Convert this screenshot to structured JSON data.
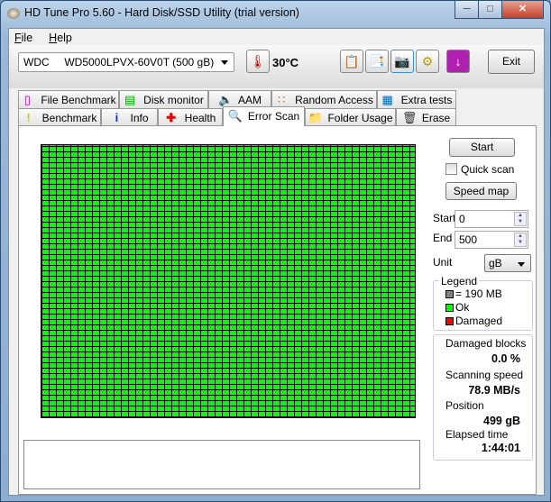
{
  "window": {
    "title": "HD Tune Pro 5.60 - Hard Disk/SSD Utility (trial version)"
  },
  "menu": [
    {
      "label": "File",
      "u": "F",
      "rest": "ile"
    },
    {
      "label": "Help",
      "u": "H",
      "rest": "elp"
    }
  ],
  "toolbar": {
    "drive": "WDC     WD5000LPVX-60V0T (500 gB)",
    "temperature": "30°C",
    "exit_label": "Exit"
  },
  "tabs_row1": [
    {
      "label": "File Benchmark",
      "icon": "file-benchmark-icon"
    },
    {
      "label": "Disk monitor",
      "icon": "disk-monitor-icon"
    },
    {
      "label": "AAM",
      "icon": "speaker-icon"
    },
    {
      "label": "Random Access",
      "icon": "random-access-icon"
    },
    {
      "label": "Extra tests",
      "icon": "extra-tests-icon"
    }
  ],
  "tabs_row2": [
    {
      "label": "Benchmark",
      "icon": "exclamation-icon"
    },
    {
      "label": "Info",
      "icon": "info-icon"
    },
    {
      "label": "Health",
      "icon": "health-cross-icon"
    },
    {
      "label": "Error Scan",
      "icon": "magnifier-icon",
      "active": true
    },
    {
      "label": "Folder Usage",
      "icon": "folder-icon"
    },
    {
      "label": "Erase",
      "icon": "trash-icon"
    }
  ],
  "controls": {
    "start_label": "Start",
    "quick_scan_label": "Quick scan",
    "quick_scan_checked": false,
    "speed_map_label": "Speed map",
    "start_field_label": "Start",
    "start_value": "0",
    "end_field_label": "End",
    "end_value": "500",
    "unit_label": "Unit",
    "unit_value": "gB"
  },
  "legend": {
    "title": "Legend",
    "items": [
      {
        "label": "= 190 MB",
        "color": "#808080"
      },
      {
        "label": "Ok",
        "color": "#00ff00"
      },
      {
        "label": "Damaged",
        "color": "#ff0000"
      }
    ]
  },
  "stats": {
    "damaged_blocks_label": "Damaged blocks",
    "damaged_blocks": "0.0 %",
    "speed_label": "Scanning speed",
    "speed": "78.9 MB/s",
    "position_label": "Position",
    "position": "499 gB",
    "elapsed_label": "Elapsed time",
    "elapsed": "1:44:01"
  },
  "scan": {
    "block_color": "#00ff00",
    "status": "all blocks ok"
  }
}
